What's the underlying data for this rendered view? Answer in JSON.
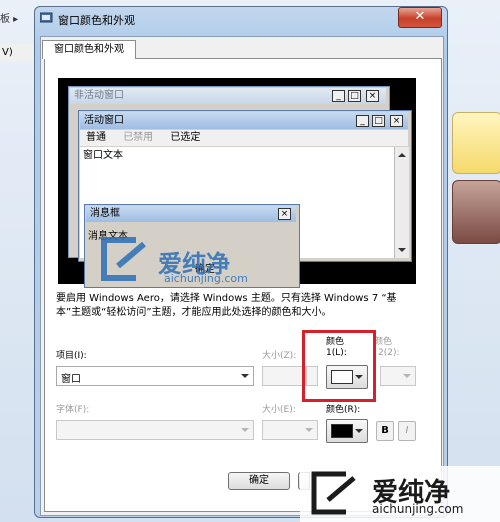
{
  "background": {
    "menu_fragment": "V)",
    "crumb_fragment": "板 ▸"
  },
  "dialog": {
    "title": "窗口颜色和外观",
    "close_glyph": "✕",
    "tab_label": "窗口颜色和外观"
  },
  "preview": {
    "inactive_title": "非活动窗口",
    "active_title": "活动窗口",
    "menu": [
      "普通",
      "已禁用",
      "已选定"
    ],
    "window_text": "窗口文本",
    "message_title": "消息框",
    "message_text": "消息文本",
    "ok_label": "确定",
    "minimize_glyph": "_",
    "maximize_glyph": "□",
    "close_glyph": "×"
  },
  "info_text": "要启用 Windows Aero，请选择 Windows 主题。只有选择 Windows 7 “基本”主题或“轻松访问”主题，才能应用此处选择的颜色和大小。",
  "form": {
    "item_label": "项目(I):",
    "item_value": "窗口",
    "size_label": "大小(Z):",
    "color1_label_line1": "颜色",
    "color1_label_line2": "1(L):",
    "color2_label_line1": "颜色",
    "color2_label_line2": "2(2):",
    "color1_value": "#ffffff",
    "font_label": "字体(F):",
    "font_size_label": "大小(E):",
    "font_color_label": "颜色(R):",
    "font_color_value": "#000000",
    "bold_label": "B",
    "italic_label": "I"
  },
  "buttons": {
    "ok_label": "确定"
  },
  "watermarks": [
    {
      "title": "爱纯净",
      "url": "aichunjing.com"
    },
    {
      "title": "爱纯净",
      "url": "aichunjing.com"
    }
  ],
  "colors": {
    "highlight_box": "#d6212a",
    "watermark_blue": "#2b6fb6"
  }
}
